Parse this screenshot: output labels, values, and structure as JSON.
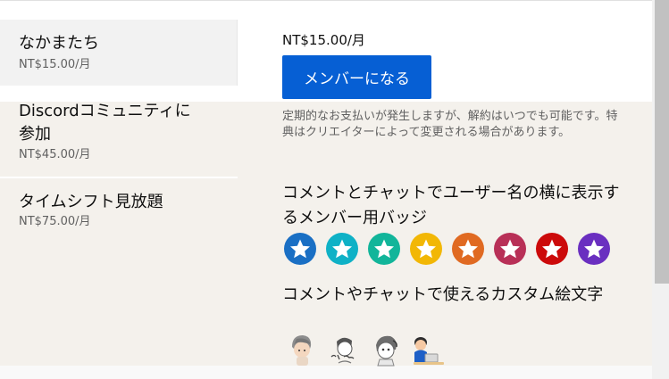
{
  "tiers": [
    {
      "name": "なかまたち",
      "price": "NT$15.00/月"
    },
    {
      "name_line1": "Discordコミュニティに",
      "name_line2": "参加",
      "price": "NT$45.00/月"
    },
    {
      "name": "タイムシフト見放題",
      "price": "NT$75.00/月"
    }
  ],
  "selected_tier": {
    "price": "NT$15.00/月",
    "join_label": "メンバーになる",
    "disclaimer": "定期的なお支払いが発生しますが、解約はいつでも可能です。特典はクリエイターによって変更される場合があります。"
  },
  "perks": {
    "badges_title": "コメントとチャットでユーザー名の横に表示するメンバー用バッジ",
    "badges": [
      {
        "icon": "star-icon",
        "color": "#1a6fc4"
      },
      {
        "icon": "star-icon",
        "color": "#0fb1c6"
      },
      {
        "icon": "star-icon",
        "color": "#12b59a"
      },
      {
        "icon": "star-icon",
        "color": "#f2b705"
      },
      {
        "icon": "star-icon",
        "color": "#e06a22"
      },
      {
        "icon": "star-icon",
        "color": "#b83057"
      },
      {
        "icon": "star-icon",
        "color": "#cc0a0a"
      },
      {
        "icon": "star-icon",
        "color": "#6a2fc0"
      }
    ],
    "emoji_title": "コメントやチャットで使えるカスタム絵文字",
    "emojis": [
      {
        "icon": "emoji-thinking-person-icon"
      },
      {
        "icon": "emoji-hai-person-icon"
      },
      {
        "icon": "emoji-panic-person-icon"
      },
      {
        "icon": "emoji-laptop-person-icon"
      }
    ]
  }
}
